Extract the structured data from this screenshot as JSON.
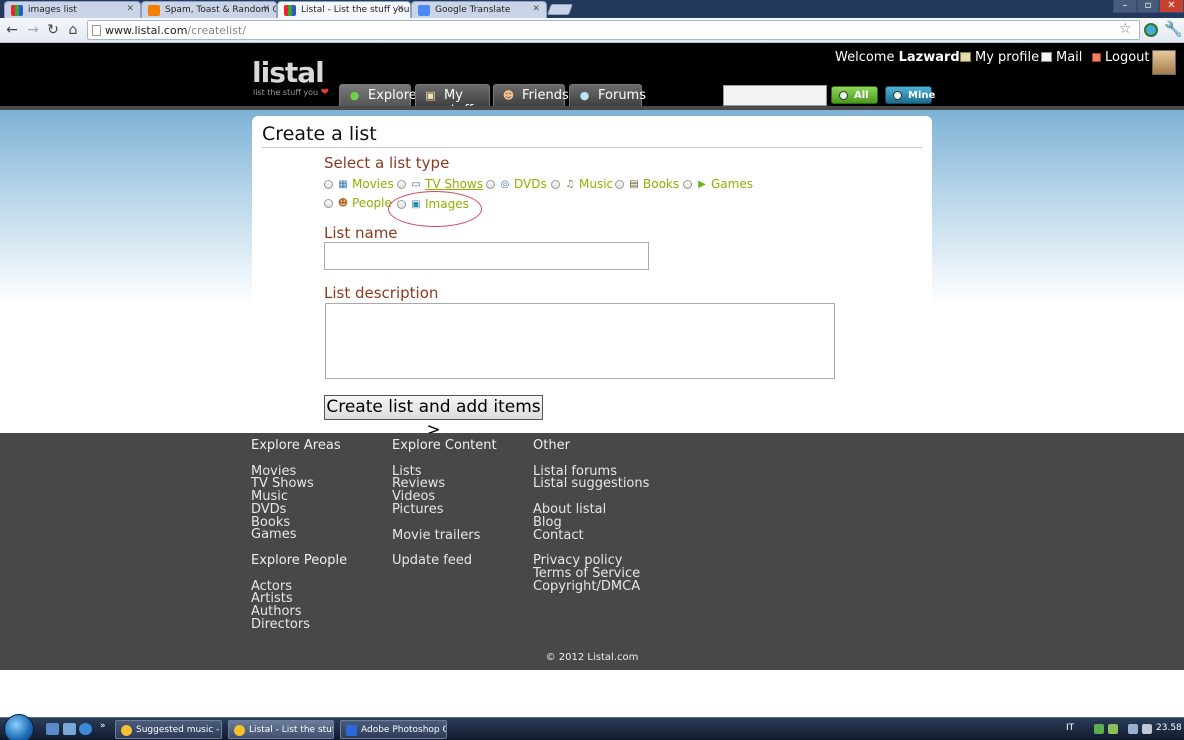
{
  "browser": {
    "tabs": [
      {
        "title": "images list"
      },
      {
        "title": "Spam, Toast & Random Q"
      },
      {
        "title": "Listal - List the stuff you lo"
      },
      {
        "title": "Google Translate"
      }
    ],
    "url_host": "www.listal.com",
    "url_path": "/createlist/"
  },
  "site": {
    "logo": "listal",
    "tagline": "list the stuff you",
    "nav": [
      {
        "label": "Explore"
      },
      {
        "label": "My stuff"
      },
      {
        "label": "Friends"
      },
      {
        "label": "Forums"
      }
    ],
    "search_all_label": "All",
    "search_mine_label": "Mine",
    "welcome_prefix": "Welcome",
    "username": "Lazward",
    "my_profile": "My profile",
    "mail": "Mail",
    "logout": "Logout"
  },
  "form": {
    "title": "Create a list",
    "select_type_label": "Select a list type",
    "list_types": [
      {
        "label": "Movies"
      },
      {
        "label": "TV Shows"
      },
      {
        "label": "DVDs"
      },
      {
        "label": "Music"
      },
      {
        "label": "Books"
      },
      {
        "label": "Games"
      },
      {
        "label": "People"
      },
      {
        "label": "Images"
      }
    ],
    "list_name_label": "List name",
    "list_name_value": "",
    "list_description_label": "List description",
    "list_description_value": "",
    "submit_label": "Create list and add items >"
  },
  "footer": {
    "explore_areas": {
      "heading": "Explore Areas",
      "links": [
        "Movies",
        "TV Shows",
        "Music",
        "DVDs",
        "Books",
        "Games"
      ]
    },
    "explore_people": {
      "heading": "Explore People",
      "links": [
        "Actors",
        "Artists",
        "Authors",
        "Directors"
      ]
    },
    "explore_content": {
      "heading": "Explore Content",
      "links": [
        "Lists",
        "Reviews",
        "Videos",
        "Pictures"
      ],
      "links2": [
        "Movie trailers"
      ],
      "links3": [
        "Update feed"
      ]
    },
    "other": {
      "heading": "Other",
      "links": [
        "Listal forums",
        "Listal suggestions"
      ],
      "links2": [
        "About listal",
        "Blog",
        "Contact"
      ],
      "links3": [
        "Privacy policy",
        "Terms of Service",
        "Copyright/DMCA"
      ]
    },
    "copyright": "© 2012 Listal.com"
  },
  "taskbar": {
    "items": [
      {
        "label": "Suggested music - ..."
      },
      {
        "label": "Listal - List the stuff ..."
      },
      {
        "label": "Adobe Photoshop C..."
      }
    ],
    "language": "IT",
    "clock": "23.58"
  }
}
